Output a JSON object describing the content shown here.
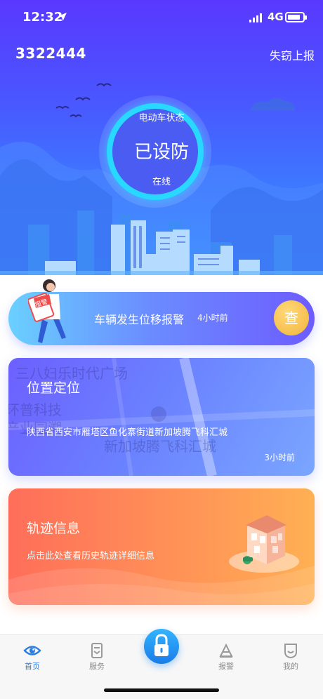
{
  "status_bar": {
    "time": "12:32",
    "network": "4G",
    "icons": [
      "location-arrow-icon",
      "signal-icon",
      "battery-icon"
    ]
  },
  "header": {
    "device_id": "3322444",
    "report_loss_label": "失窃上报"
  },
  "vehicle_status": {
    "title": "电动车状态",
    "state": "已设防",
    "online": "在线",
    "ring_color": "#28d8ff"
  },
  "alert": {
    "text": "车辆发生位移报警",
    "time": "4小时前",
    "check_label": "查",
    "sign_text": "报警"
  },
  "location": {
    "title": "位置定位",
    "address": "陕西省西安市雁塔区鱼化寨街道新加坡腾飞科汇城",
    "time": "3小时前",
    "map_labels": [
      "三八妇乐时代广场",
      "环普科技",
      "产业园溯",
      "新加坡腾飞科汇城"
    ]
  },
  "track": {
    "title": "轨迹信息",
    "description": "点击此处查看历史轨迹详细信息"
  },
  "tabbar": {
    "home": "首页",
    "service": "服务",
    "alarm": "报警",
    "mine": "我的",
    "active_color": "#2a7de1"
  },
  "colors": {
    "hero_top": "#5a38ff",
    "hero_bottom": "#3aa0ff",
    "track_start": "#ff6e5a",
    "track_end": "#ffb054"
  }
}
